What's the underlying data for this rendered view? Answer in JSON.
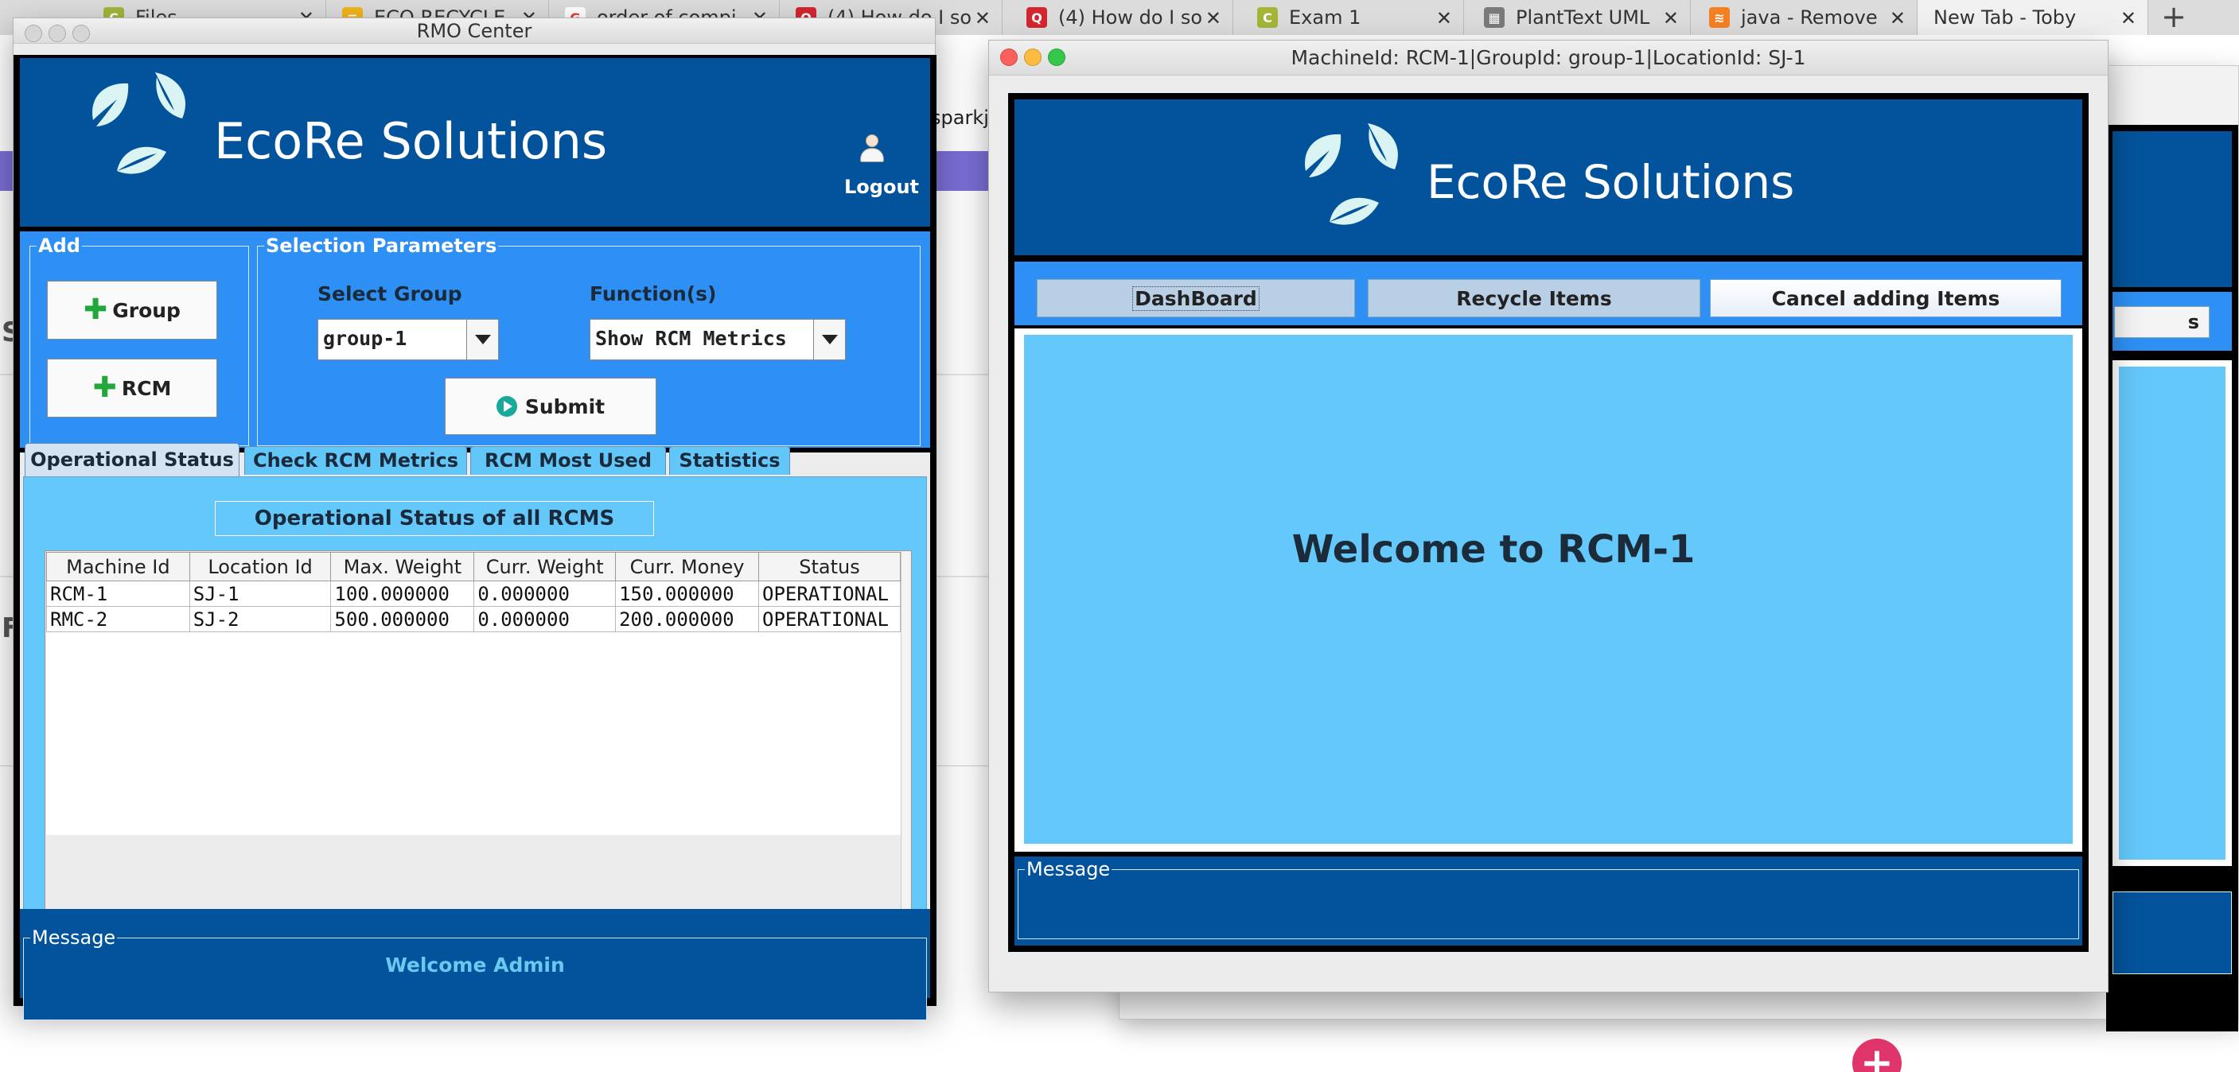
{
  "browser": {
    "tabs": [
      {
        "label": "Files",
        "icon_color": "#a4b53a",
        "icon": "C"
      },
      {
        "label": "ECO RECYCLE",
        "icon_color": "#f2b51b",
        "icon": "≡"
      },
      {
        "label": "order of compi",
        "icon_color": "#e53935",
        "icon": "G"
      },
      {
        "label": "(4) How do I so",
        "icon_color": "#d3272f",
        "icon": "Q"
      },
      {
        "label": "(4) How do I so",
        "icon_color": "#d3272f",
        "icon": "Q"
      },
      {
        "label": "Exam 1",
        "icon_color": "#a4b53a",
        "icon": "C"
      },
      {
        "label": "PlantText UML",
        "icon_color": "#7a7a7a",
        "icon": "▦"
      },
      {
        "label": "java - Remove",
        "icon_color": "#f48024",
        "icon": "≋"
      },
      {
        "label": "New Tab - Toby",
        "icon_color": "",
        "icon": ""
      }
    ],
    "new_tab_symbol": "+",
    "bg_sparkj": "sparkj",
    "bg_letter_s": "S",
    "bg_letter_f": "F",
    "fab_symbol": "+"
  },
  "brand": {
    "name": "EcoRe Solutions",
    "leaf_color": "#d9f4f3"
  },
  "rmo": {
    "title": "RMO Center",
    "logout_label": "Logout",
    "add_legend": "Add",
    "group_button": "Group",
    "rcm_button": "RCM",
    "selection_legend": "Selection Parameters",
    "select_group_label": "Select Group",
    "select_group_value": "group-1",
    "functions_label": "Function(s)",
    "functions_value": "Show RCM Metrics",
    "submit_button": "Submit",
    "tabs": [
      "Operational Status",
      "Check RCM Metrics",
      "RCM Most Used",
      "Statistics"
    ],
    "table_title": "Operational Status of all RCMS",
    "columns": [
      "Machine Id",
      "Location Id",
      "Max. Weight",
      "Curr. Weight",
      "Curr. Money",
      "Status"
    ],
    "rows": [
      [
        "RCM-1",
        "SJ-1",
        "100.000000",
        "0.000000",
        "150.000000",
        "OPERATIONAL"
      ],
      [
        "RMC-2",
        "SJ-2",
        "500.000000",
        "0.000000",
        "200.000000",
        "OPERATIONAL"
      ]
    ],
    "message_legend": "Message",
    "message_text": "Welcome Admin"
  },
  "rcm": {
    "title": "MachineId: RCM-1|GroupId: group-1|LocationId: SJ-1",
    "nav": [
      "DashBoard",
      "Recycle Items",
      "Cancel adding Items"
    ],
    "welcome": "Welcome to RCM-1",
    "message_legend": "Message"
  },
  "win3": {
    "button_fragment": "s"
  },
  "colors": {
    "banner_blue": "#03539c",
    "bright_blue": "#2e90f5",
    "light_blue": "#64c8fb",
    "message_text": "#6bc8ef"
  }
}
